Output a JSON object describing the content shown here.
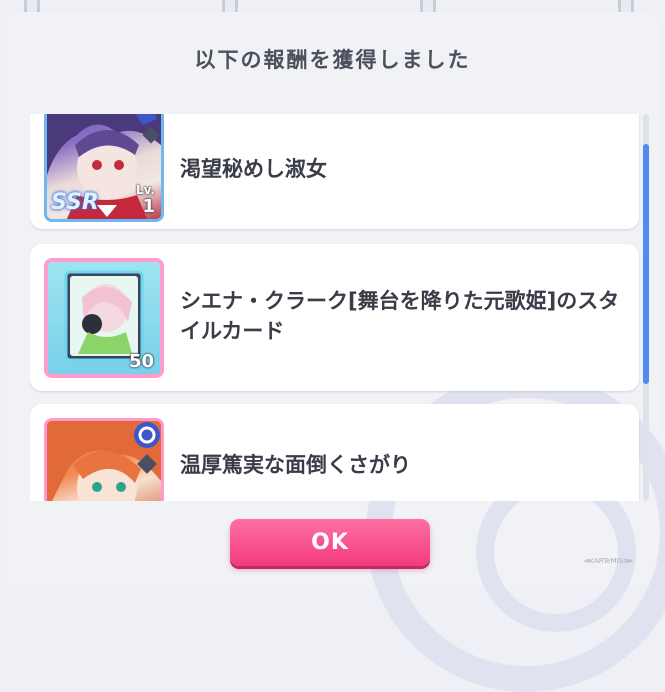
{
  "dialog": {
    "title": "以下の報酬を獲得しました",
    "ok_label": "OK"
  },
  "rewards": [
    {
      "label": "渇望秘めし淑女",
      "rarity": "SSR",
      "level_label": "Lv.",
      "level": "1",
      "thumb_icon": "character-portrait-icon"
    },
    {
      "label": "シエナ・クラーク[舞台を降りた元歌姫]のスタイルカード",
      "quantity": "50",
      "thumb_icon": "style-card-icon"
    },
    {
      "label": "温厚篤実な面倒くさがり",
      "thumb_icon": "character-portrait-icon"
    }
  ],
  "watermark": "⋘ARTeMIS⋙"
}
